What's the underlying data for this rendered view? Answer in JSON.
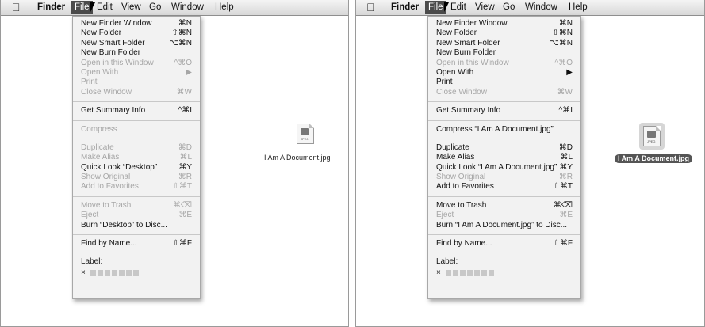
{
  "menubar": {
    "app_name": "Finder",
    "items": [
      "File",
      "Edit",
      "View",
      "Go",
      "Window",
      "Help"
    ]
  },
  "left": {
    "menu": [
      {
        "type": "item",
        "label": "New Finder Window",
        "shortcut": "⌘N",
        "enabled": true
      },
      {
        "type": "item",
        "label": "New Folder",
        "shortcut": "⇧⌘N",
        "enabled": true
      },
      {
        "type": "item",
        "label": "New Smart Folder",
        "shortcut": "⌥⌘N",
        "enabled": true
      },
      {
        "type": "item",
        "label": "New Burn Folder",
        "shortcut": "",
        "enabled": true
      },
      {
        "type": "item",
        "label": "Open in this Window",
        "shortcut": "^⌘O",
        "enabled": false
      },
      {
        "type": "item",
        "label": "Open With",
        "shortcut": "▶",
        "enabled": false
      },
      {
        "type": "item",
        "label": "Print",
        "shortcut": "",
        "enabled": false
      },
      {
        "type": "item",
        "label": "Close Window",
        "shortcut": "⌘W",
        "enabled": false
      },
      {
        "type": "sep"
      },
      {
        "type": "item",
        "label": "Get Summary Info",
        "shortcut": "^⌘I",
        "enabled": true
      },
      {
        "type": "sep"
      },
      {
        "type": "item",
        "label": "Compress",
        "shortcut": "",
        "enabled": false
      },
      {
        "type": "sep"
      },
      {
        "type": "item",
        "label": "Duplicate",
        "shortcut": "⌘D",
        "enabled": false
      },
      {
        "type": "item",
        "label": "Make Alias",
        "shortcut": "⌘L",
        "enabled": false
      },
      {
        "type": "item",
        "label": "Quick Look “Desktop”",
        "shortcut": "⌘Y",
        "enabled": true
      },
      {
        "type": "item",
        "label": "Show Original",
        "shortcut": "⌘R",
        "enabled": false
      },
      {
        "type": "item",
        "label": "Add to Favorites",
        "shortcut": "⇧⌘T",
        "enabled": false
      },
      {
        "type": "sep"
      },
      {
        "type": "item",
        "label": "Move to Trash",
        "shortcut": "⌘⌫",
        "enabled": false
      },
      {
        "type": "item",
        "label": "Eject",
        "shortcut": "⌘E",
        "enabled": false
      },
      {
        "type": "item",
        "label": "Burn “Desktop” to Disc...",
        "shortcut": "",
        "enabled": true
      },
      {
        "type": "sep"
      },
      {
        "type": "item",
        "label": "Find by Name...",
        "shortcut": "⇧⌘F",
        "enabled": true
      },
      {
        "type": "sep"
      },
      {
        "type": "item",
        "label": "Label:",
        "shortcut": "",
        "enabled": true
      },
      {
        "type": "labels"
      }
    ],
    "file_name": "I Am A Document.jpg",
    "file_selected": false
  },
  "right": {
    "menu": [
      {
        "type": "item",
        "label": "New Finder Window",
        "shortcut": "⌘N",
        "enabled": true
      },
      {
        "type": "item",
        "label": "New Folder",
        "shortcut": "⇧⌘N",
        "enabled": true
      },
      {
        "type": "item",
        "label": "New Smart Folder",
        "shortcut": "⌥⌘N",
        "enabled": true
      },
      {
        "type": "item",
        "label": "New Burn Folder",
        "shortcut": "",
        "enabled": true
      },
      {
        "type": "item",
        "label": "Open in this Window",
        "shortcut": "^⌘O",
        "enabled": false
      },
      {
        "type": "item",
        "label": "Open With",
        "shortcut": "▶",
        "enabled": true
      },
      {
        "type": "item",
        "label": "Print",
        "shortcut": "",
        "enabled": true
      },
      {
        "type": "item",
        "label": "Close Window",
        "shortcut": "⌘W",
        "enabled": false
      },
      {
        "type": "sep"
      },
      {
        "type": "item",
        "label": "Get Summary Info",
        "shortcut": "^⌘I",
        "enabled": true
      },
      {
        "type": "sep"
      },
      {
        "type": "item",
        "label": "Compress “I Am A Document.jpg”",
        "shortcut": "",
        "enabled": true
      },
      {
        "type": "sep"
      },
      {
        "type": "item",
        "label": "Duplicate",
        "shortcut": "⌘D",
        "enabled": true
      },
      {
        "type": "item",
        "label": "Make Alias",
        "shortcut": "⌘L",
        "enabled": true
      },
      {
        "type": "item",
        "label": "Quick Look “I Am A Document.jpg”",
        "shortcut": "⌘Y",
        "enabled": true
      },
      {
        "type": "item",
        "label": "Show Original",
        "shortcut": "⌘R",
        "enabled": false
      },
      {
        "type": "item",
        "label": "Add to Favorites",
        "shortcut": "⇧⌘T",
        "enabled": true
      },
      {
        "type": "sep"
      },
      {
        "type": "item",
        "label": "Move to Trash",
        "shortcut": "⌘⌫",
        "enabled": true
      },
      {
        "type": "item",
        "label": "Eject",
        "shortcut": "⌘E",
        "enabled": false
      },
      {
        "type": "item",
        "label": "Burn “I Am A Document.jpg” to Disc...",
        "shortcut": "",
        "enabled": true
      },
      {
        "type": "sep"
      },
      {
        "type": "item",
        "label": "Find by Name...",
        "shortcut": "⇧⌘F",
        "enabled": true
      },
      {
        "type": "sep"
      },
      {
        "type": "item",
        "label": "Label:",
        "shortcut": "",
        "enabled": true
      },
      {
        "type": "labels"
      }
    ],
    "file_name": "I Am A Document.jpg",
    "file_selected": true
  },
  "file_icon_tag": "JPEG",
  "label_clear_glyph": "×",
  "colors": {
    "menubar_bg": "#e2e2e2",
    "menu_bg": "#f2f2f2",
    "disabled_text": "#a6a6a6",
    "selection": "#555555"
  },
  "icons": {
    "apple": "apple-logo-icon",
    "cursor": "mouse-pointer-icon",
    "document": "jpeg-document-icon"
  }
}
